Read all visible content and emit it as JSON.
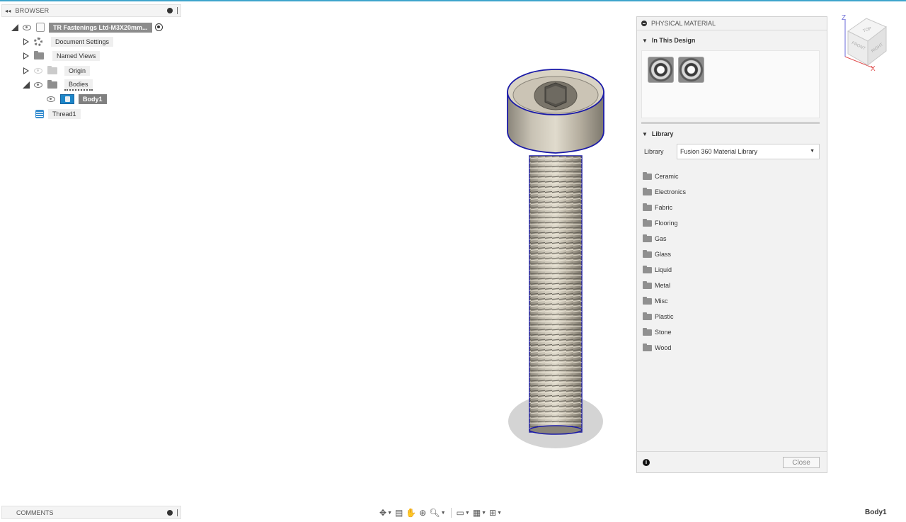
{
  "browser": {
    "title": "BROWSER",
    "items": [
      {
        "label": "TR Fastenings Ltd-M3X20mm..."
      },
      {
        "label": "Document Settings"
      },
      {
        "label": "Named Views"
      },
      {
        "label": "Origin"
      },
      {
        "label": "Bodies"
      },
      {
        "label": "Body1"
      },
      {
        "label": "Thread1"
      }
    ]
  },
  "comments": {
    "title": "COMMENTS"
  },
  "status": {
    "selection": "Body1"
  },
  "physical_material": {
    "title": "PHYSICAL MATERIAL",
    "in_this_design": "In This Design",
    "library_section": "Library",
    "library_label": "Library",
    "library_value": "Fusion 360 Material Library",
    "categories": [
      "Ceramic",
      "Electronics",
      "Fabric",
      "Flooring",
      "Gas",
      "Glass",
      "Liquid",
      "Metal",
      "Misc",
      "Plastic",
      "Stone",
      "Wood"
    ],
    "close_label": "Close",
    "info_symbol": "i"
  },
  "viewcube": {
    "z": "Z",
    "x": "X",
    "top": "TOP",
    "front": "FRONT",
    "right": "RIGHT"
  },
  "colors": {
    "accent": "#1d86c8",
    "selection_outline": "#1a1aa8",
    "top_bar": "#3ea4cc"
  }
}
